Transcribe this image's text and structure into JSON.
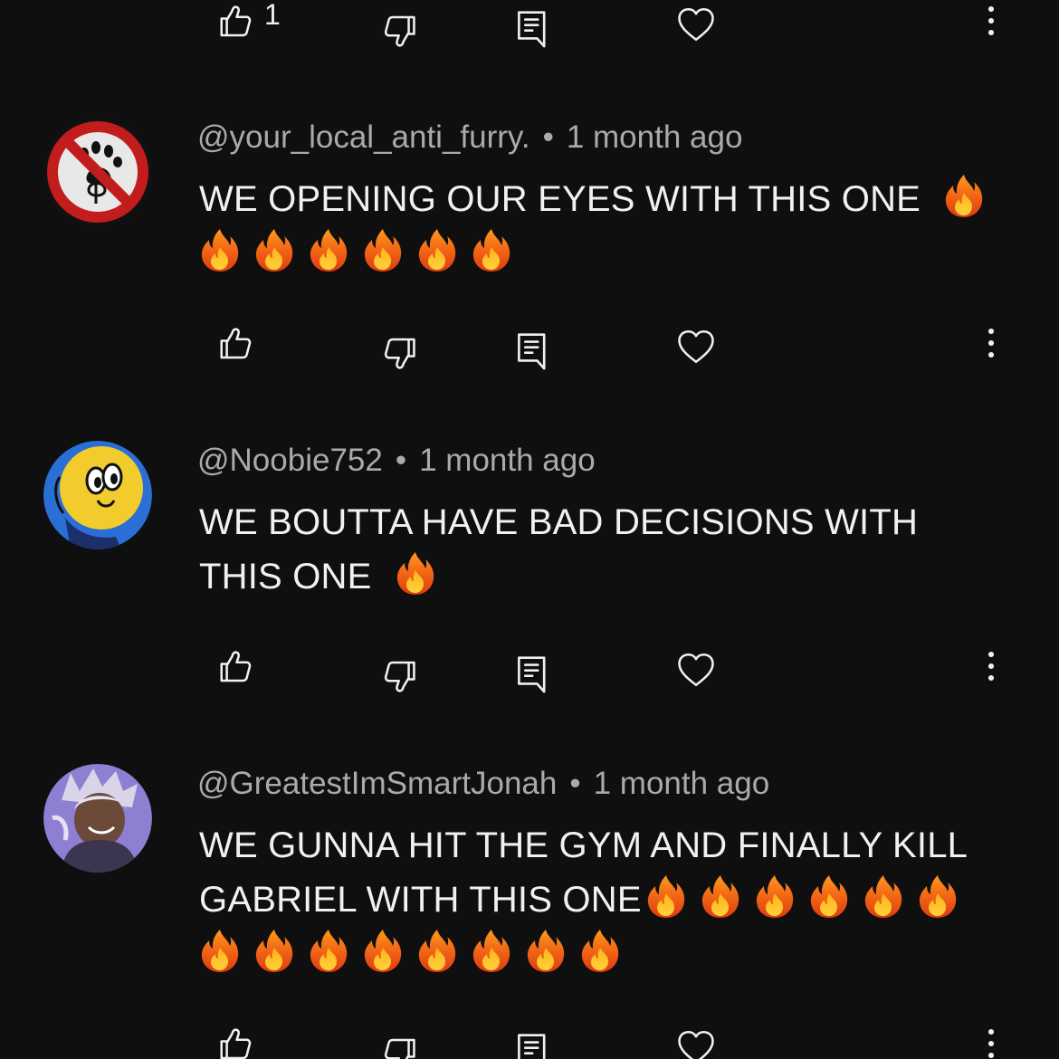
{
  "top_actions": {
    "like_count": "1"
  },
  "comments": [
    {
      "author": "@your_local_anti_furry.",
      "separator": "•",
      "time": "1 month ago",
      "text_line1": "WE OPENING OUR EYES WITH THIS ONE",
      "emoji_count": 7,
      "emoji": "fire"
    },
    {
      "author": "@Noobie752",
      "separator": "•",
      "time": "1 month ago",
      "text_line1": "WE BOUTTA HAVE BAD DECISIONS WITH",
      "text_line2": "THIS ONE",
      "emoji_count": 1,
      "emoji": "fire"
    },
    {
      "author": "@GreatestImSmartJonah",
      "separator": "•",
      "time": "1 month ago",
      "text_line1": "WE GUNNA HIT THE GYM AND FINALLY KILL",
      "text_line2": "GABRIEL WITH THIS ONE",
      "emoji_count": 14,
      "emoji": "fire"
    }
  ],
  "icons": [
    "thumbs-up-icon",
    "thumbs-down-icon",
    "reply-icon",
    "heart-icon",
    "more-vertical-icon",
    "fire-emoji"
  ],
  "colors": {
    "background": "#0f0f0f",
    "text": "#f1f1f1",
    "meta": "#aaaaaa"
  }
}
